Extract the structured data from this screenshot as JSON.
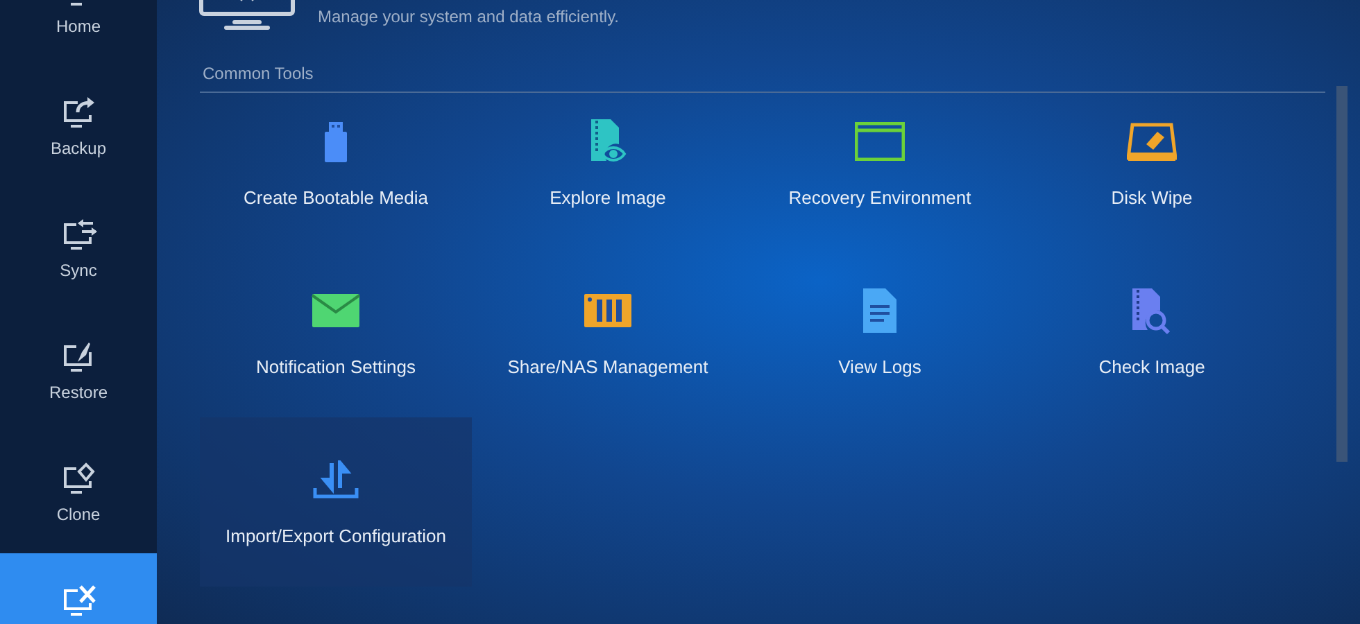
{
  "sidebar": {
    "items": [
      {
        "label": "Home",
        "selected": false
      },
      {
        "label": "Backup",
        "selected": false
      },
      {
        "label": "Sync",
        "selected": false
      },
      {
        "label": "Restore",
        "selected": false
      },
      {
        "label": "Clone",
        "selected": false
      },
      {
        "selected": true
      }
    ]
  },
  "header": {
    "subtitle": "Manage your system and data efficiently."
  },
  "section": {
    "title": "Common Tools",
    "tools": [
      {
        "label": "Create Bootable Media",
        "hovered": false
      },
      {
        "label": "Explore Image",
        "hovered": false
      },
      {
        "label": "Recovery Environment",
        "hovered": false
      },
      {
        "label": "Disk Wipe",
        "hovered": false
      },
      {
        "label": "Notification Settings",
        "hovered": false
      },
      {
        "label": "Share/NAS Management",
        "hovered": false
      },
      {
        "label": "View Logs",
        "hovered": false
      },
      {
        "label": "Check Image",
        "hovered": false
      },
      {
        "label": "Import/Export Configuration",
        "hovered": true
      }
    ]
  }
}
